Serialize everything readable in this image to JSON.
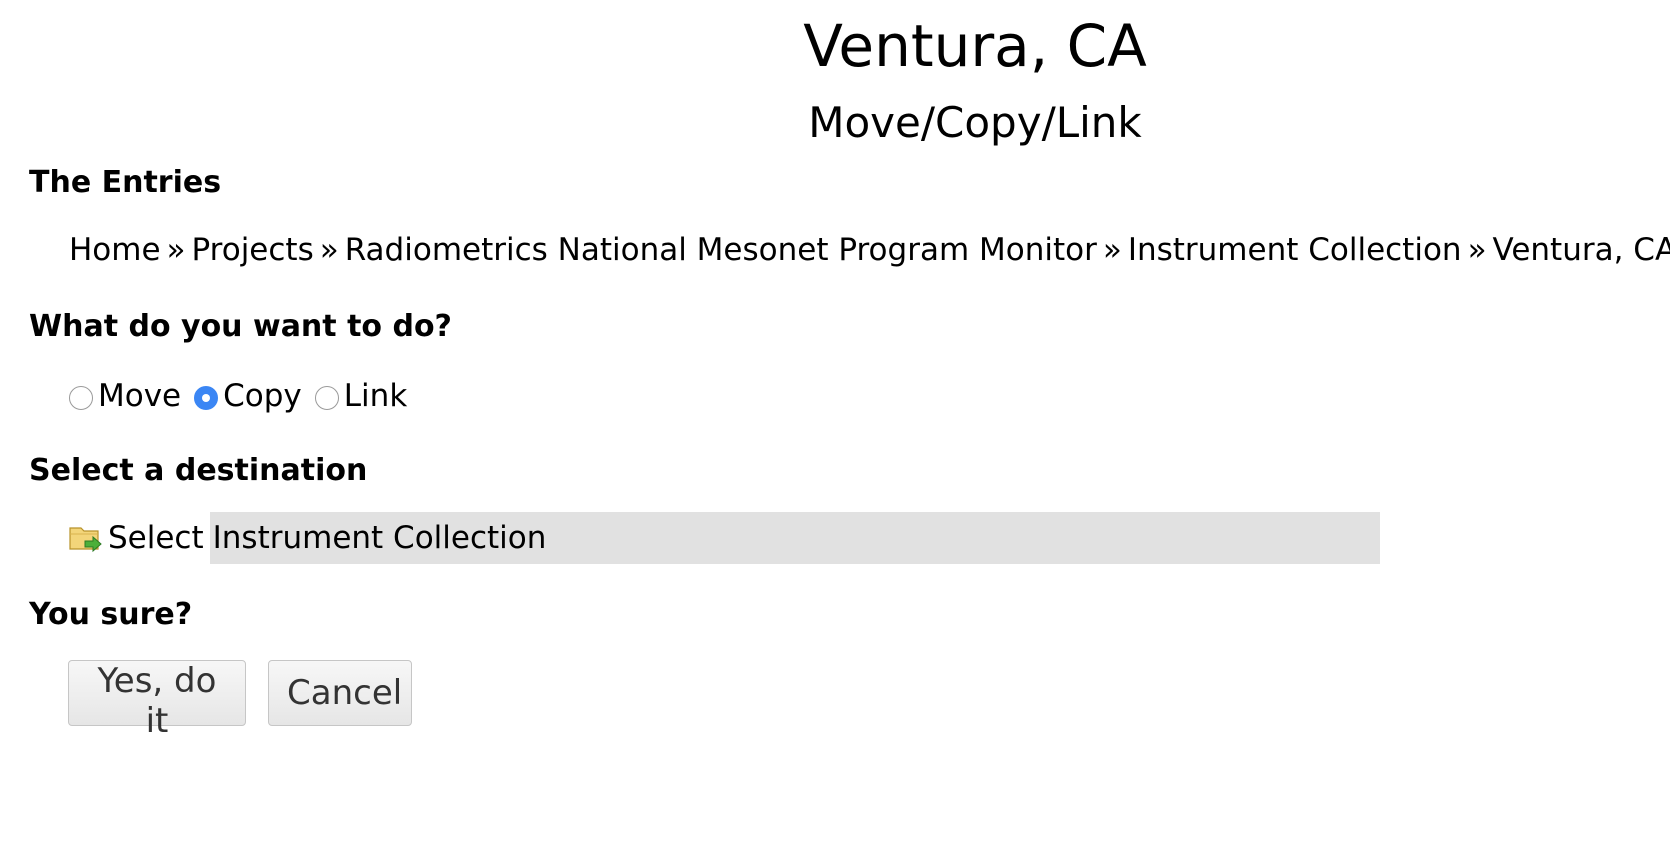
{
  "page": {
    "title": "Ventura, CA",
    "subtitle": "Move/Copy/Link"
  },
  "entries": {
    "label": "The Entries",
    "breadcrumb": [
      "Home",
      "Projects",
      "Radiometrics National Mesonet Program Monitor",
      "Instrument Collection",
      "Ventura, CA"
    ],
    "separator": "»"
  },
  "action": {
    "label": "What do you want to do?",
    "options": [
      {
        "label": "Move",
        "checked": false
      },
      {
        "label": "Copy",
        "checked": true
      },
      {
        "label": "Link",
        "checked": false
      }
    ]
  },
  "destination": {
    "label": "Select a destination",
    "icon": "folder-move-icon",
    "select_label": "Select",
    "value": "Instrument Collection"
  },
  "confirm": {
    "label": "You sure?",
    "yes_label": "Yes, do it",
    "cancel_label": "Cancel"
  },
  "colors": {
    "radio_checked": "#3b86f4",
    "field_bg": "#e1e1e1"
  }
}
